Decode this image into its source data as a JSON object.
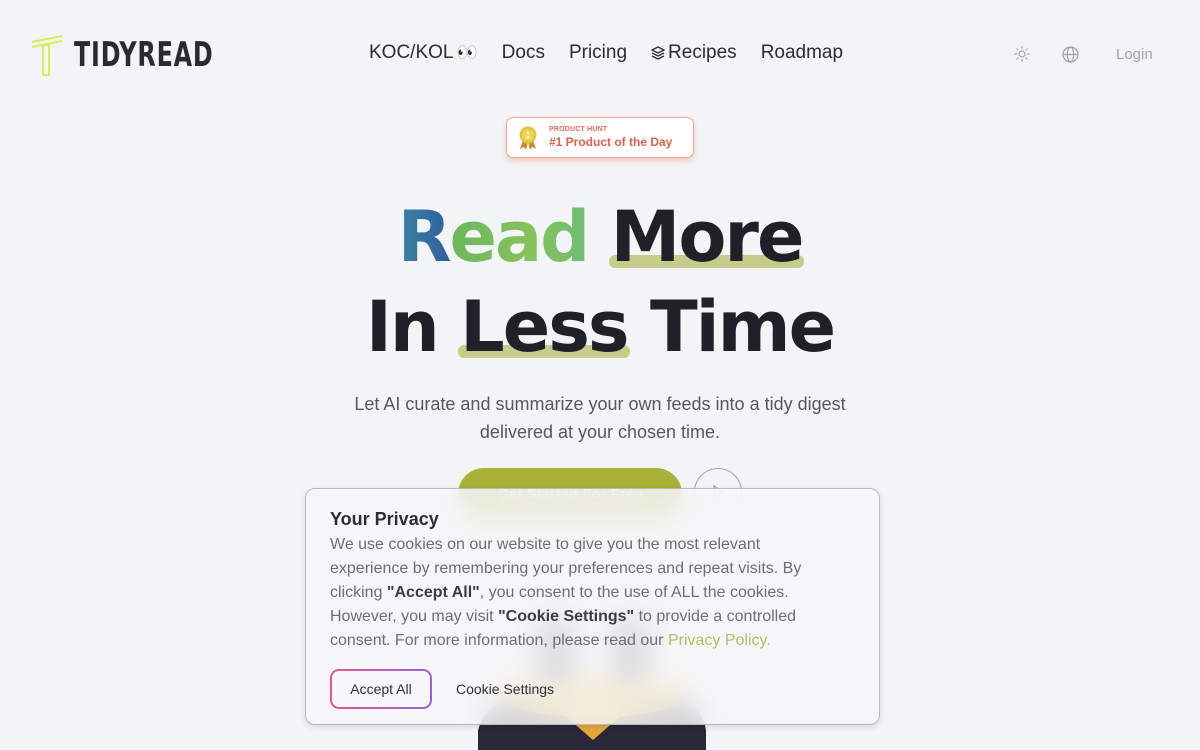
{
  "brand": {
    "name": "TIDYREAD",
    "logo_icon": "t-logo-icon",
    "logo_color": "#d9ec5a"
  },
  "nav": {
    "items": [
      {
        "label": "KOC/KOL",
        "suffix": "👀"
      },
      {
        "label": "Docs"
      },
      {
        "label": "Pricing"
      },
      {
        "label": "Recipes",
        "icon": "stack-icon"
      },
      {
        "label": "Roadmap"
      }
    ]
  },
  "tools": {
    "theme_icon": "sun-icon",
    "language_icon": "globe-icon",
    "login_label": "Login"
  },
  "badge": {
    "kicker": "PRODUCT HUNT",
    "title": "#1 Product of the Day",
    "icon": "medal-icon",
    "color": "#e0604b"
  },
  "hero": {
    "line1_gradient": "Read",
    "line1_highlight": "More",
    "line2_prefix": "In",
    "line2_highlight": "Less",
    "line2_suffix": "Time",
    "subtitle_1": "Let AI curate and summarize your own feeds into a tidy digest",
    "subtitle_2": "delivered at your chosen time.",
    "cta_label": "Get Started For Free",
    "play_icon": "play-icon"
  },
  "cookie": {
    "title": "Your Privacy",
    "text_1": "We use cookies on our website to give you the most relevant experience by remembering your preferences and repeat visits. By clicking ",
    "bold_1": "\"Accept All\"",
    "text_2": ", you consent to the use of ALL the cookies. However, you may visit ",
    "bold_2": "\"Cookie Settings\"",
    "text_3": " to provide a controlled consent. For more information, please read our ",
    "link": "Privacy Policy.",
    "accept_label": "Accept All",
    "settings_label": "Cookie Settings"
  },
  "colors": {
    "accent": "#a9b136",
    "background": "#f3f4f6",
    "highlight": "#c8cc8a",
    "link": "#b3bc63"
  }
}
